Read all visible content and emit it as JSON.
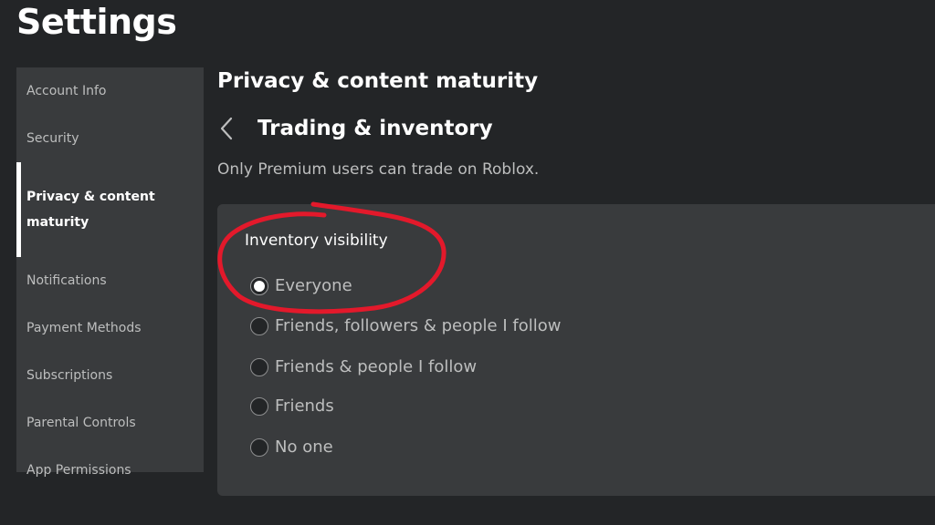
{
  "page": {
    "title": "Settings"
  },
  "sidebar": {
    "items": [
      {
        "label": "Account Info",
        "active": false
      },
      {
        "label": "Security",
        "active": false
      },
      {
        "label": "Privacy & content maturity",
        "active": true
      },
      {
        "label": "Notifications",
        "active": false
      },
      {
        "label": "Payment Methods",
        "active": false
      },
      {
        "label": "Subscriptions",
        "active": false
      },
      {
        "label": "Parental Controls",
        "active": false
      },
      {
        "label": "App Permissions",
        "active": false
      }
    ]
  },
  "main": {
    "section_title": "Privacy & content maturity",
    "back_icon": "chevron-left-icon",
    "sub_title": "Trading & inventory",
    "notice": "Only Premium users can trade on Roblox.",
    "inventory_visibility": {
      "label": "Inventory visibility",
      "selected": "Everyone",
      "options": [
        {
          "label": "Everyone",
          "checked": true
        },
        {
          "label": "Friends, followers & people I follow",
          "checked": false
        },
        {
          "label": "Friends & people I follow",
          "checked": false
        },
        {
          "label": "Friends",
          "checked": false
        },
        {
          "label": "No one",
          "checked": false
        }
      ]
    }
  },
  "annotation": {
    "type": "hand-drawn circle",
    "color": "#e3192b",
    "target": "Inventory visibility / Everyone"
  },
  "colors": {
    "background": "#232527",
    "panel": "#393b3d",
    "text_primary": "#ffffff",
    "text_secondary": "#bdbebe"
  }
}
